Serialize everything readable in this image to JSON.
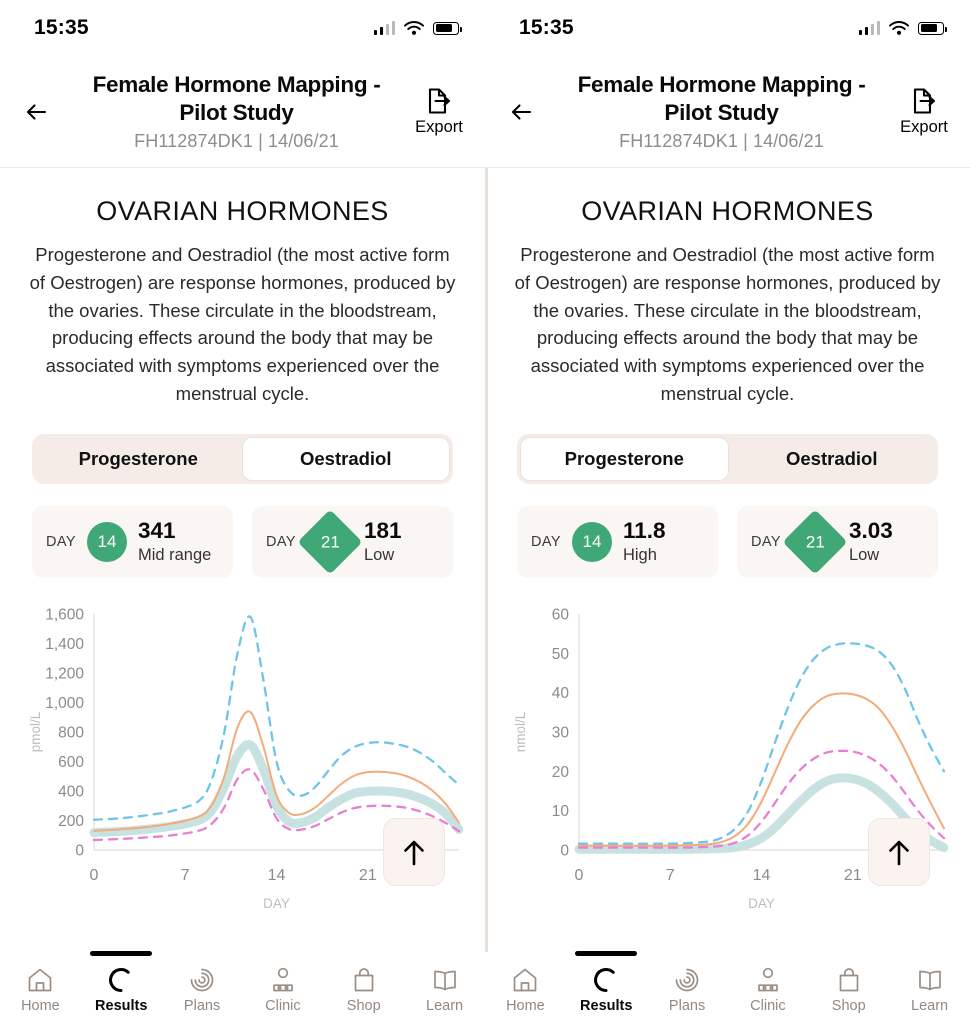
{
  "status": {
    "time": "15:35",
    "signal_icon": "signal-bars-icon",
    "wifi_icon": "wifi-icon",
    "battery_icon": "battery-icon"
  },
  "header": {
    "back_icon": "arrow-left-icon",
    "title": "Female Hormone Mapping - Pilot Study",
    "subtitle": "FH112874DK1 | 14/06/21",
    "export_label": "Export",
    "export_icon": "export-document-icon"
  },
  "section": {
    "title": "OVARIAN HORMONES",
    "body": "Progesterone and Oestradiol (the most active form of Oestrogen) are response hormones, produced by the ovaries. These circulate in the bloodstream, producing effects around the body that may be associated with symptoms experienced over the menstrual cycle."
  },
  "tabs": {
    "progesterone": "Progesterone",
    "oestradiol": "Oestradiol"
  },
  "panels": {
    "left": {
      "active_tab": "Oestradiol",
      "cards": [
        {
          "day_label": "DAY",
          "day": "14",
          "shape": "circle",
          "value": "341",
          "state": "Mid range"
        },
        {
          "day_label": "DAY",
          "day": "21",
          "shape": "diamond",
          "value": "181",
          "state": "Low"
        }
      ]
    },
    "right": {
      "active_tab": "Progesterone",
      "cards": [
        {
          "day_label": "DAY",
          "day": "14",
          "shape": "circle",
          "value": "11.8",
          "state": "High"
        },
        {
          "day_label": "DAY",
          "day": "21",
          "shape": "diamond",
          "value": "3.03",
          "state": "Low"
        }
      ]
    }
  },
  "scroll_top": {
    "icon": "arrow-up-icon"
  },
  "bottom_nav": {
    "items": [
      {
        "label": "Home",
        "icon": "home-icon",
        "active": false
      },
      {
        "label": "Results",
        "icon": "ring-icon",
        "active": true
      },
      {
        "label": "Plans",
        "icon": "spiral-icon",
        "active": false
      },
      {
        "label": "Clinic",
        "icon": "clinician-icon",
        "active": false
      },
      {
        "label": "Shop",
        "icon": "shopping-bag-icon",
        "active": false
      },
      {
        "label": "Learn",
        "icon": "open-book-icon",
        "active": false
      }
    ]
  },
  "colors": {
    "reference_upper": "#6ec5e8",
    "reference_median": "#f4ab7a",
    "reference_lower": "#e87fd0",
    "patient_line": "#c5e0e0",
    "accent_green": "#3fa876",
    "segment_bg": "#f5ece7",
    "card_bg": "#faf6f4"
  },
  "chart_data": [
    {
      "id": "oestradiol-chart",
      "type": "line",
      "title": "Oestradiol",
      "xlabel": "DAY",
      "ylabel": "pmol/L",
      "xlim": [
        0,
        28
      ],
      "ylim": [
        0,
        1600
      ],
      "xticks": [
        0,
        7,
        14,
        21
      ],
      "yticks": [
        0,
        200,
        400,
        600,
        800,
        1000,
        1200,
        1400,
        1600
      ],
      "ytick_labels": [
        "0",
        "200",
        "400",
        "600",
        "800",
        "1,000",
        "1,200",
        "1,400",
        "1,600"
      ],
      "grid": false,
      "legend": "none",
      "x": [
        0,
        2,
        4,
        6,
        8,
        9,
        10,
        11,
        12,
        13,
        14,
        15,
        16,
        17,
        18,
        19,
        20,
        21,
        22,
        23,
        24,
        25,
        26,
        27,
        28
      ],
      "series": [
        {
          "name": "Reference upper",
          "style": "dashed",
          "color": "#6ec5e8",
          "values": [
            205,
            215,
            235,
            265,
            330,
            470,
            800,
            1330,
            1580,
            1150,
            600,
            400,
            370,
            430,
            540,
            640,
            700,
            725,
            730,
            720,
            700,
            660,
            600,
            520,
            440
          ]
        },
        {
          "name": "Reference median",
          "style": "solid",
          "color": "#f4ab7a",
          "values": [
            130,
            140,
            155,
            180,
            225,
            300,
            500,
            830,
            935,
            700,
            370,
            250,
            245,
            290,
            370,
            450,
            505,
            528,
            530,
            522,
            500,
            460,
            400,
            310,
            185
          ]
        },
        {
          "name": "Reference lower",
          "style": "dashed",
          "color": "#e87fd0",
          "values": [
            68,
            75,
            85,
            100,
            130,
            175,
            290,
            480,
            545,
            410,
            215,
            140,
            140,
            165,
            210,
            255,
            285,
            297,
            300,
            296,
            285,
            262,
            228,
            182,
            128
          ]
        },
        {
          "name": "Patient",
          "style": "thick",
          "color": "#c5e0e0",
          "values": [
            118,
            126,
            140,
            162,
            200,
            265,
            430,
            640,
            712,
            545,
            300,
            190,
            188,
            225,
            290,
            345,
            385,
            398,
            400,
            395,
            380,
            352,
            310,
            245,
            140
          ]
        }
      ],
      "markers": [
        {
          "day": 14,
          "value": 341
        },
        {
          "day": 21,
          "value": 181
        }
      ]
    },
    {
      "id": "progesterone-chart",
      "type": "line",
      "title": "Progesterone",
      "xlabel": "DAY",
      "ylabel": "nmol/L",
      "xlim": [
        0,
        28
      ],
      "ylim": [
        0,
        60
      ],
      "xticks": [
        0,
        7,
        14,
        21
      ],
      "yticks": [
        0,
        10,
        20,
        30,
        40,
        50,
        60
      ],
      "ytick_labels": [
        "0",
        "10",
        "20",
        "30",
        "40",
        "50",
        "60"
      ],
      "grid": false,
      "legend": "none",
      "x": [
        0,
        2,
        4,
        6,
        8,
        10,
        11,
        12,
        13,
        14,
        15,
        16,
        17,
        18,
        19,
        20,
        21,
        22,
        23,
        24,
        25,
        26,
        27,
        28
      ],
      "series": [
        {
          "name": "Reference upper",
          "style": "dashed",
          "color": "#6ec5e8",
          "values": [
            1.6,
            1.6,
            1.6,
            1.6,
            1.7,
            2.2,
            3.2,
            5.5,
            10.0,
            17.5,
            27.0,
            36.0,
            43.5,
            48.5,
            51.3,
            52.4,
            52.5,
            52.0,
            50.5,
            47.0,
            41.0,
            33.0,
            26.0,
            20.0
          ]
        },
        {
          "name": "Reference median",
          "style": "solid",
          "color": "#f4ab7a",
          "values": [
            1.1,
            1.1,
            1.1,
            1.1,
            1.2,
            1.5,
            2.1,
            3.6,
            6.8,
            12.3,
            19.5,
            26.8,
            32.8,
            36.8,
            39.1,
            39.8,
            39.6,
            38.5,
            36.0,
            31.5,
            25.5,
            18.5,
            11.8,
            5.5
          ]
        },
        {
          "name": "Reference lower",
          "style": "dashed",
          "color": "#e87fd0",
          "values": [
            0.6,
            0.6,
            0.6,
            0.6,
            0.6,
            0.8,
            1.1,
            1.9,
            3.8,
            7.2,
            11.8,
            16.6,
            20.5,
            23.2,
            24.8,
            25.2,
            25.0,
            24.0,
            22.0,
            18.8,
            14.5,
            10.0,
            6.2,
            3.0
          ]
        },
        {
          "name": "Patient",
          "style": "thick",
          "color": "#c5e0e0",
          "values": [
            0.2,
            0.2,
            0.2,
            0.2,
            0.2,
            0.3,
            0.4,
            0.7,
            1.5,
            3.0,
            5.6,
            9.0,
            12.4,
            15.4,
            17.5,
            18.3,
            18.1,
            17.0,
            14.8,
            11.8,
            8.2,
            5.0,
            2.4,
            0.6
          ]
        }
      ],
      "markers": [
        {
          "day": 14,
          "value": 11.8
        },
        {
          "day": 21,
          "value": 3.03
        }
      ]
    }
  ]
}
